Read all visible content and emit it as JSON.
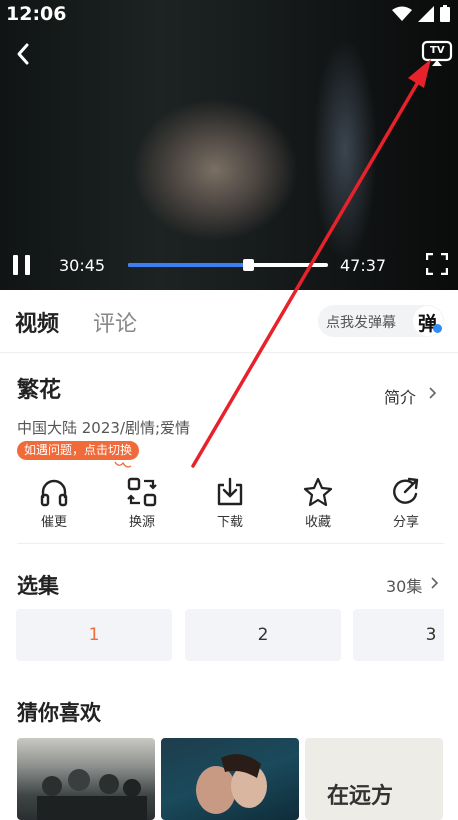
{
  "status_bar": {
    "time": "12:06"
  },
  "player": {
    "current_time": "30:45",
    "duration": "47:37",
    "progress_fraction": 0.6,
    "buffered_fraction": 0.8,
    "tv_label": "TV"
  },
  "tabs": [
    {
      "label": "视频"
    },
    {
      "label": "评论"
    }
  ],
  "danmu": {
    "label": "点我发弹幕",
    "icon_char": "弹"
  },
  "show": {
    "title": "繁花",
    "intro_label": "简介",
    "meta": "中国大陆 2023/剧情;爱情",
    "switch_hint": "如遇问题，点击切换"
  },
  "actions": [
    {
      "label": "催更",
      "icon": "headphones-icon"
    },
    {
      "label": "换源",
      "icon": "switch-source-icon"
    },
    {
      "label": "下载",
      "icon": "download-icon"
    },
    {
      "label": "收藏",
      "icon": "star-icon"
    },
    {
      "label": "分享",
      "icon": "share-icon"
    }
  ],
  "episodes": {
    "title": "选集",
    "count_label": "30集",
    "items": [
      "1",
      "2",
      "3"
    ],
    "selected_index": 0
  },
  "recommend": {
    "title": "猜你喜欢",
    "thumb_texts": [
      "在远方"
    ]
  },
  "colors": {
    "accent": "#f06a3a",
    "progress_blue": "#3a7ff3",
    "arrow_red": "#e8222a",
    "danmu_badge_blue": "#2f8cf7"
  }
}
